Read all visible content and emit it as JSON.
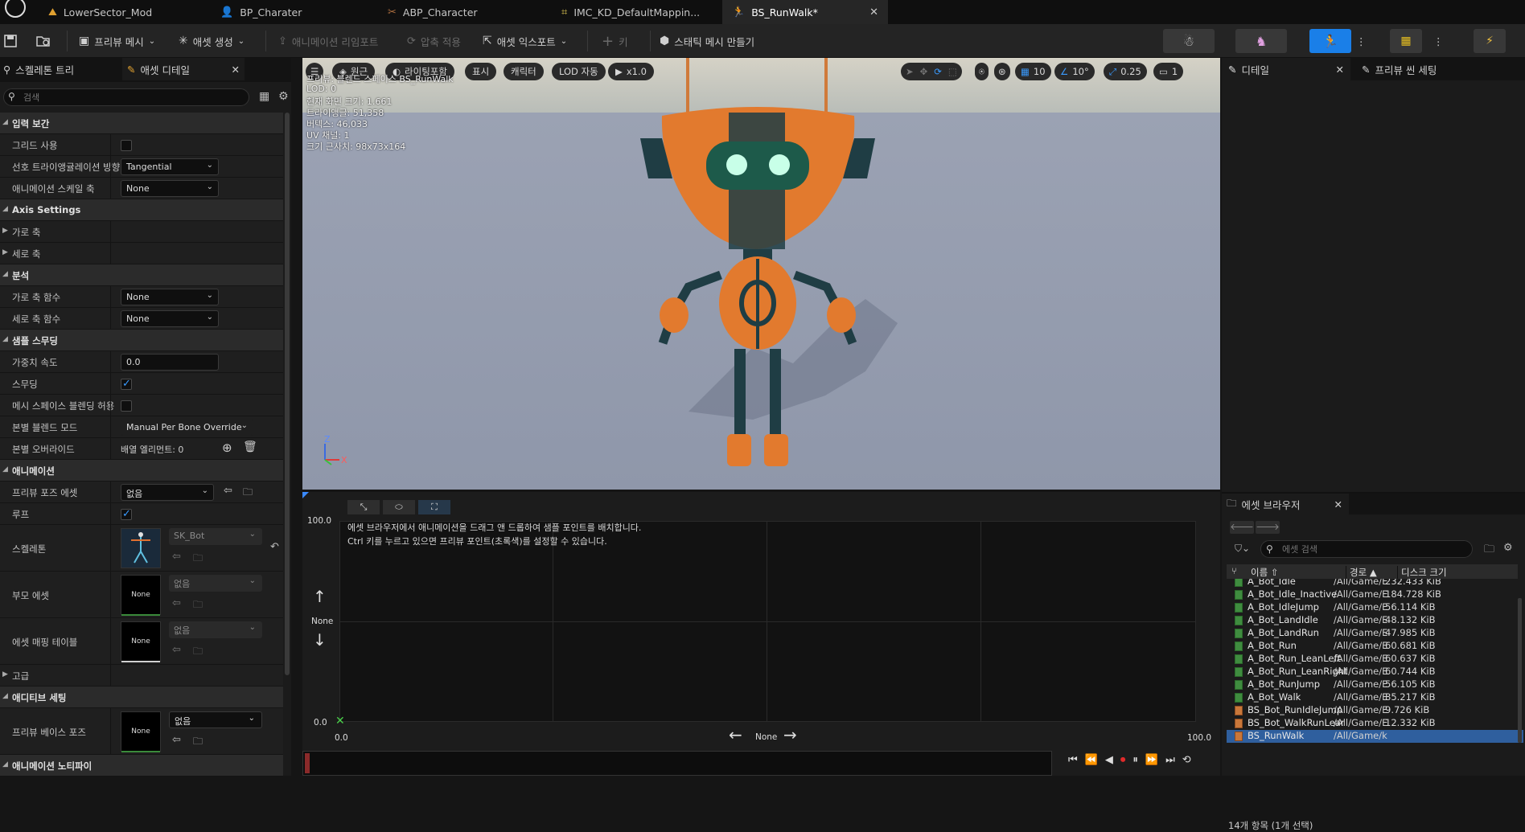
{
  "tabs": [
    {
      "label": "LowerSector_Mod"
    },
    {
      "label": "BP_Charater"
    },
    {
      "label": "ABP_Character"
    },
    {
      "label": "IMC_KD_DefaultMappin..."
    },
    {
      "label": "BS_RunWalk*"
    }
  ],
  "toolbar": {
    "preview_mesh": "프리뷰 메시",
    "create_asset": "애셋 생성",
    "anim_reimport": "애니메이션 리임포트",
    "apply_compression": "압축 적용",
    "export_asset": "애셋 익스포트",
    "key": "키",
    "make_static_mesh": "스태틱 메시 만들기"
  },
  "left_panel": {
    "tab_skeleton_tree": "스켈레톤 트리",
    "tab_asset_details": "애셋 디테일",
    "search_placeholder": "검색",
    "sections": {
      "input_interp": "입력 보간",
      "axis_settings": "Axis Settings",
      "analysis": "분석",
      "sample_smoothing": "샘플 스무딩",
      "animation": "애니메이션",
      "advanced": "고급",
      "additive_settings": "애디티브 세팅",
      "anim_notify": "애니메이션 노티파이"
    },
    "props": {
      "use_grid": "그리드 사용",
      "pref_triangulation": "선호 트라이앵귤레이션 방향",
      "pref_triangulation_val": "Tangential",
      "anim_scale_axis": "애니메이션 스케일 축",
      "anim_scale_axis_val": "None",
      "h_axis": "가로 축",
      "v_axis": "세로 축",
      "h_axis_func": "가로 축 함수",
      "h_axis_func_val": "None",
      "v_axis_func": "세로 축 함수",
      "v_axis_func_val": "None",
      "weight_speed": "가중치 속도",
      "weight_speed_val": "0.0",
      "smoothing": "스무딩",
      "mesh_space_blend": "메시 스페이스 블렌딩 허용",
      "per_bone_mode": "본별 블렌드 모드",
      "per_bone_mode_val": "Manual Per Bone Override",
      "per_bone_override": "본별 오버라이드",
      "array_elements": "배열 엘리먼트: 0",
      "preview_pose_asset": "프리뷰 포즈 에셋",
      "preview_pose_val": "없음",
      "loop": "루프",
      "skeleton": "스켈레톤",
      "skeleton_val": "SK_Bot",
      "parent_asset": "부모 에셋",
      "parent_asset_val": "없음",
      "asset_mapping_table": "에셋 매핑 테이블",
      "asset_mapping_val": "없음",
      "thumb_none": "None",
      "preview_base_pose": "프리뷰 베이스 포즈",
      "preview_base_pose_val": "없음"
    }
  },
  "viewport": {
    "perspective": "원근",
    "lit": "라이팅포함",
    "show": "표시",
    "character": "캐릭터",
    "lod": "LOD 자동",
    "speed": "x1.0",
    "grid_snap": "10",
    "rot_snap": "10°",
    "scale_snap": "0.25",
    "cam_speed": "1",
    "stats": [
      "프리뷰: 블렌드 스페이스 BS_RunWalk",
      "LOD: 0",
      "현재 화면 크기: 1.661",
      "트라이앵글: 51,358",
      "버텍스: 46,033",
      "UV 채널: 1",
      "크기 근사치: 98x73x164"
    ]
  },
  "graph": {
    "hint1": "에셋 브라우저에서 애니메이션을 드래그 앤 드롭하여 샘플 포인트를 배치합니다.",
    "hint2": "Ctrl 키를 누르고 있으면 프리뷰 포인트(초록색)를 설정할 수 있습니다.",
    "y_max": "100.0",
    "y_min": "0.0",
    "x_min": "0.0",
    "x_max": "100.0",
    "y_axis_label": "None",
    "x_axis_label": "None"
  },
  "right_panel": {
    "tab_details": "디테일",
    "tab_preview_scene": "프리뷰 씬 세팅",
    "asset_browser_tab": "에셋 브라우저",
    "search_placeholder": "에셋 검색",
    "col_name": "이름",
    "col_path": "경로",
    "col_size": "디스크 크기",
    "items": [
      {
        "name": "A_Bot_Idle",
        "path": "/All/Game/E",
        "size": "232.433 KiB",
        "type": "anim"
      },
      {
        "name": "A_Bot_Idle_Inactive",
        "path": "/All/Game/E",
        "size": "184.728 KiB",
        "type": "anim"
      },
      {
        "name": "A_Bot_IdleJump",
        "path": "/All/Game/E",
        "size": "56.114 KiB",
        "type": "anim"
      },
      {
        "name": "A_Bot_LandIdle",
        "path": "/All/Game/E",
        "size": "48.132 KiB",
        "type": "anim"
      },
      {
        "name": "A_Bot_LandRun",
        "path": "/All/Game/E",
        "size": "47.985 KiB",
        "type": "anim"
      },
      {
        "name": "A_Bot_Run",
        "path": "/All/Game/E",
        "size": "60.681 KiB",
        "type": "anim"
      },
      {
        "name": "A_Bot_Run_LeanLeft",
        "path": "/All/Game/E",
        "size": "60.637 KiB",
        "type": "anim"
      },
      {
        "name": "A_Bot_Run_LeanRight",
        "path": "/All/Game/E",
        "size": "60.744 KiB",
        "type": "anim"
      },
      {
        "name": "A_Bot_RunJump",
        "path": "/All/Game/E",
        "size": "56.105 KiB",
        "type": "anim"
      },
      {
        "name": "A_Bot_Walk",
        "path": "/All/Game/E",
        "size": "85.217 KiB",
        "type": "anim"
      },
      {
        "name": "BS_Bot_RunIdleJump",
        "path": "/All/Game/E",
        "size": "9.726 KiB",
        "type": "bs"
      },
      {
        "name": "BS_Bot_WalkRunLear",
        "path": "/All/Game/E",
        "size": "12.332 KiB",
        "type": "bs"
      },
      {
        "name": "BS_RunWalk",
        "path": "/All/Game/k",
        "size": "",
        "type": "bs"
      }
    ],
    "status": "14개 항목 (1개 선택)"
  }
}
